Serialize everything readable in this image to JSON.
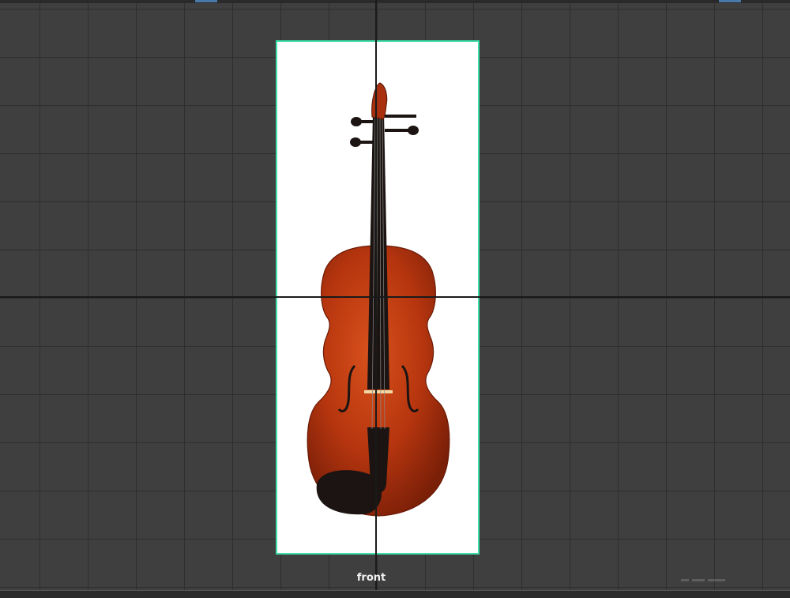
{
  "viewport": {
    "view_name": "front",
    "grid": "on"
  },
  "image_plane": {
    "subject": "violin",
    "border_color": "#3fe0a8",
    "background_color": "#ffffff"
  },
  "colors": {
    "viewport_background": "#3f3f3f",
    "grid_line": "#2e2e2e",
    "axis_line": "#1a1a1a",
    "violin_body": "#b8360f",
    "violin_dark": "#1b1412"
  }
}
